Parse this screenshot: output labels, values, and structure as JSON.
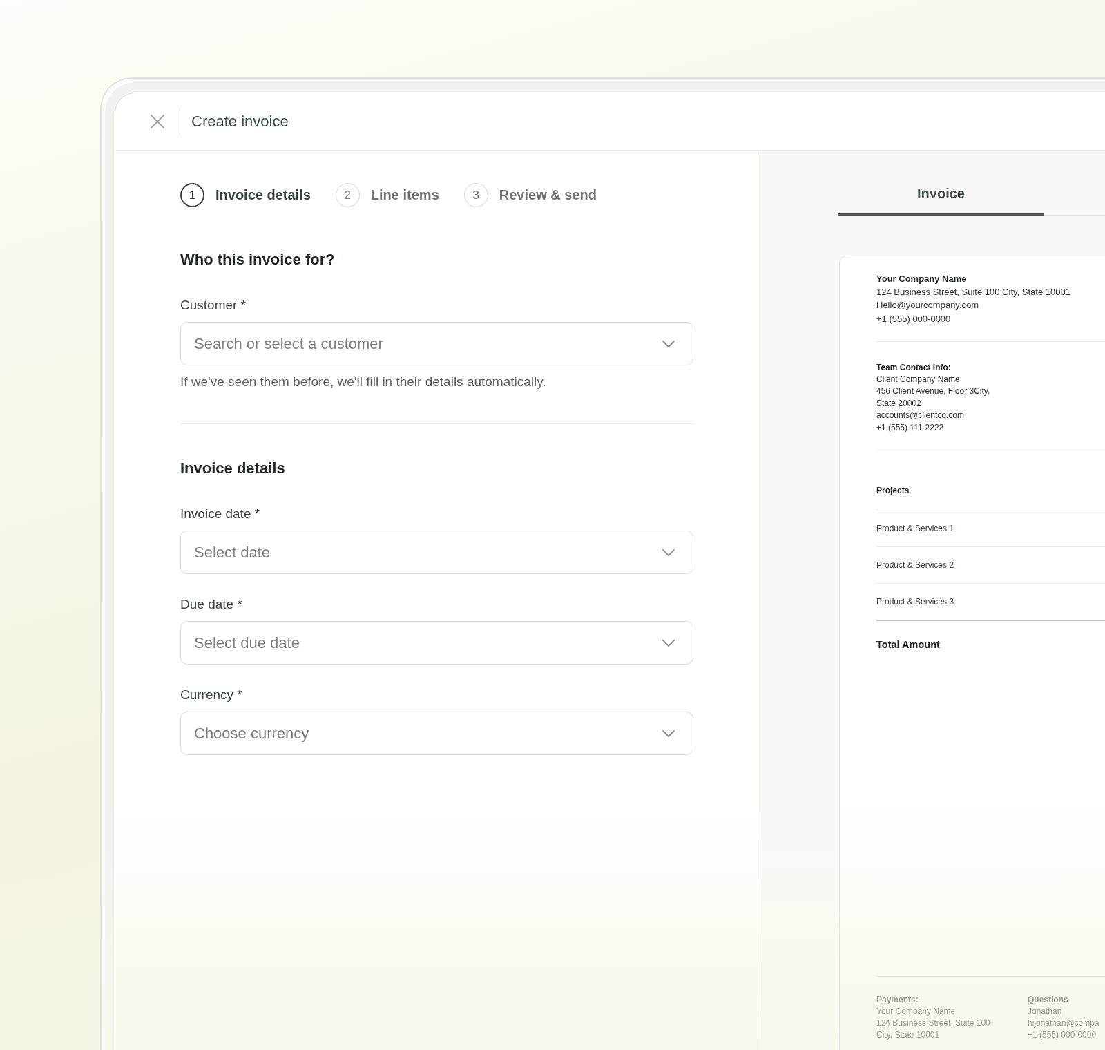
{
  "window": {
    "title": "Create invoice"
  },
  "steps": [
    {
      "number": "1",
      "label": "Invoice details",
      "selected": true
    },
    {
      "number": "2",
      "label": "Line items",
      "selected": false
    },
    {
      "number": "3",
      "label": "Review & send",
      "selected": false
    }
  ],
  "form": {
    "sections": [
      {
        "heading": "Who this invoice for?",
        "fields": [
          {
            "label": "Customer *",
            "placeholder": "Search or select a customer",
            "help_text": "If we've seen them before, we'll fill in their details automatically."
          }
        ]
      },
      {
        "heading": "Invoice details",
        "fields": [
          {
            "label": "Invoice date *",
            "placeholder": "Select date"
          },
          {
            "label": "Due date *",
            "placeholder": "Select due date"
          },
          {
            "label": "Currency *",
            "placeholder": "Choose currency"
          }
        ]
      }
    ]
  },
  "preview": {
    "tabs": [
      {
        "label": "Invoice",
        "selected": true
      }
    ],
    "sender": {
      "name": "Your Company Name",
      "lines": [
        "124 Business Street, Suite 100 City, State 10001",
        "Hello@yourcompany.com",
        "+1 (555) 000-0000"
      ]
    },
    "client": {
      "title": "Team Contact Info:",
      "lines": [
        "Client Company Name",
        "456 Client Avenue, Floor 3City,",
        "State 20002",
        "accounts@clientco.com",
        "+1 (555) 111-2222"
      ]
    },
    "projects": {
      "heading": "Projects",
      "items": [
        "Product & Services 1",
        "Product & Services 2",
        "Product & Services 3"
      ]
    },
    "total_label": "Total Amount",
    "footer": [
      {
        "heading": "Payments:",
        "lines": [
          "Your Company Name",
          "124 Business Street, Suite 100",
          "City, State 10001"
        ]
      },
      {
        "heading": "Questions",
        "lines": [
          "Jonathan",
          "hijonathan@compa",
          "+1 (555) 000-0000"
        ]
      }
    ]
  }
}
